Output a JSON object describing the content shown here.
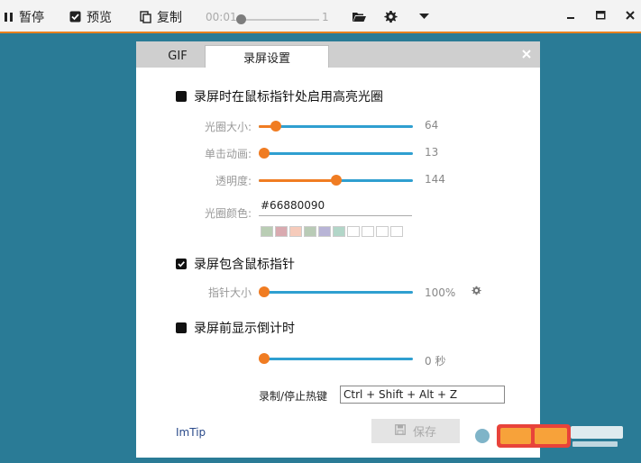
{
  "toolbar": {
    "pause_label": "暂停",
    "preview_label": "预览",
    "copy_label": "复制",
    "time": "00:01",
    "frame_count": "1",
    "playback_progress": 0
  },
  "dialog": {
    "tabs": [
      {
        "label": "GIF",
        "active": false
      },
      {
        "label": "录屏设置",
        "active": true
      }
    ],
    "highlight": {
      "checkbox_label": "录屏时在鼠标指针处启用高亮光圈",
      "checked": false,
      "size": {
        "label": "光圈大小:",
        "value": "64",
        "fraction": 0.08
      },
      "click_anim": {
        "label": "单击动画:",
        "value": "13",
        "fraction": 0.0
      },
      "opacity": {
        "label": "透明度:",
        "value": "144",
        "fraction": 0.5
      },
      "color": {
        "label": "光圈颜色:",
        "value": "#66880090"
      },
      "swatches": [
        "#b9cdb4",
        "#d9aab0",
        "#f6cbbb",
        "#b9cbb6",
        "#b8b4d6",
        "#b2d6c8",
        "#ffffff",
        "#ffffff",
        "#ffffff",
        "#ffffff"
      ]
    },
    "pointer": {
      "checkbox_label": "录屏包含鼠标指针",
      "checked": true,
      "size": {
        "label": "指针大小",
        "value": "100%",
        "fraction": 0.0
      }
    },
    "countdown": {
      "checkbox_label": "录屏前显示倒计时",
      "checked": false,
      "value": "0 秒",
      "fraction": 0.0
    },
    "hotkey": {
      "label": "录制/停止热键",
      "value": "Ctrl + Shift + Alt + Z"
    },
    "imtip": "ImTip",
    "save_label": "保存"
  },
  "colors": {
    "accent": "#f07c22",
    "track": "#2f9fd0",
    "background": "#2a7b96"
  }
}
